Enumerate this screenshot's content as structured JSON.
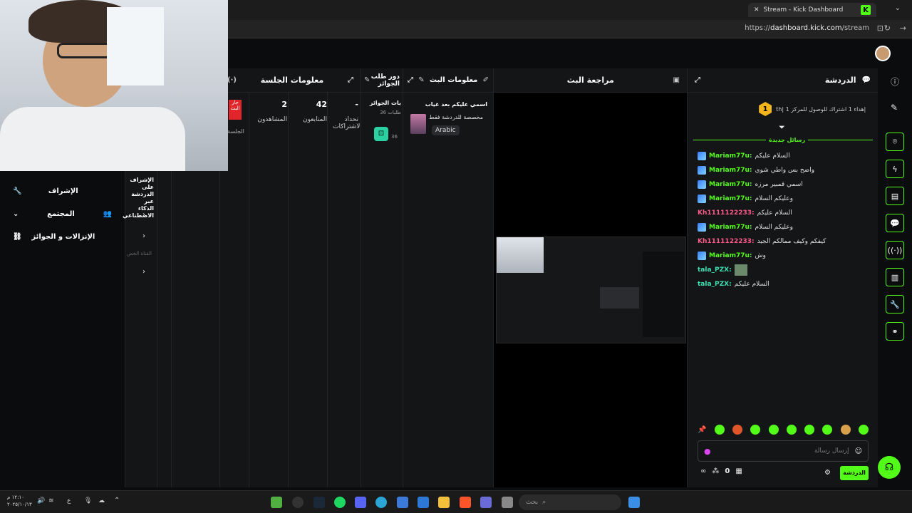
{
  "browser": {
    "tab_title": "Stream - Kick Dashboard",
    "url_prefix": "https://",
    "url_host": "dashboard.kick.com",
    "url_path": "/stream"
  },
  "panels": {
    "chat": {
      "title": "الدردشة",
      "goal_text": "إهداء 1 اشتراك للوصول للمركز 1 |th",
      "goal_rank": "1",
      "new_messages_label": "رسائل جديدة",
      "messages": [
        {
          "user": "Mariam77u",
          "text": "السلام عليكم",
          "color": "green",
          "badge": true
        },
        {
          "user": "Mariam77u",
          "text": "واضح بس واطي شوي",
          "color": "green",
          "badge": true
        },
        {
          "user": "Mariam77u",
          "text": "اسمي قمبير مرزه",
          "color": "green",
          "badge": true
        },
        {
          "user": "Mariam77u",
          "text": "وعليكم السلام",
          "color": "green",
          "badge": true
        },
        {
          "user": "Kh1111122233",
          "text": "السلام عليكم",
          "color": "pink",
          "badge": false
        },
        {
          "user": "Mariam77u",
          "text": "وعليكم السلام",
          "color": "green",
          "badge": true
        },
        {
          "user": "Kh1111122233",
          "text": "كيفكم وكيف ممالكم الجيد",
          "color": "pink",
          "badge": false
        },
        {
          "user": "Mariam77u",
          "text": "وش",
          "color": "green",
          "badge": true
        },
        {
          "user": "tala_PZX",
          "text": "",
          "color": "teal",
          "badge": false
        },
        {
          "user": "tala_PZX",
          "text": "السلام عليكم",
          "color": "teal",
          "badge": false
        }
      ],
      "input_placeholder": "إرسال رسالة",
      "send_label": "الدردشة",
      "viewer_count": "0"
    },
    "preview": {
      "title": "مراجعة البث"
    },
    "stream_info": {
      "title": "معلومات البث",
      "stream_title": "اسمي عليكم بعد غياب",
      "category": "مخصصة للدردشة فقط",
      "language": "Arabic"
    },
    "rewards": {
      "title": "دور طلب الجوائز",
      "subtitle": "بات الجوائز",
      "requests": "طلبات 36",
      "count": "36"
    },
    "session": {
      "title": "معلومات الجلسة",
      "stats": [
        {
          "value": "-",
          "label": "تحداد الاشتراكات"
        },
        {
          "value": "42",
          "label": "المتابعون"
        },
        {
          "value": "2",
          "label": "المشاهدون"
        }
      ],
      "live_badge": "جار البث",
      "session_label": "الجلسة"
    }
  },
  "sidebar": {
    "items": [
      {
        "label": "الإشراف"
      },
      {
        "label": "المجتمع"
      },
      {
        "label": "الإنزالات و الجوائز"
      }
    ],
    "mod_panel_text": "الإشراف على الدردشة عبر الذكاء الاصطناعي",
    "channel_label": "القناة الخض"
  },
  "taskbar": {
    "search_placeholder": "بحث",
    "time": "١٢:١٠ م",
    "date": "٢٠٢٥/١٠/١٣",
    "lang": "ع"
  },
  "colors": {
    "accent": "#53fc18",
    "bg": "#0b0c0d",
    "panel": "#141517"
  }
}
